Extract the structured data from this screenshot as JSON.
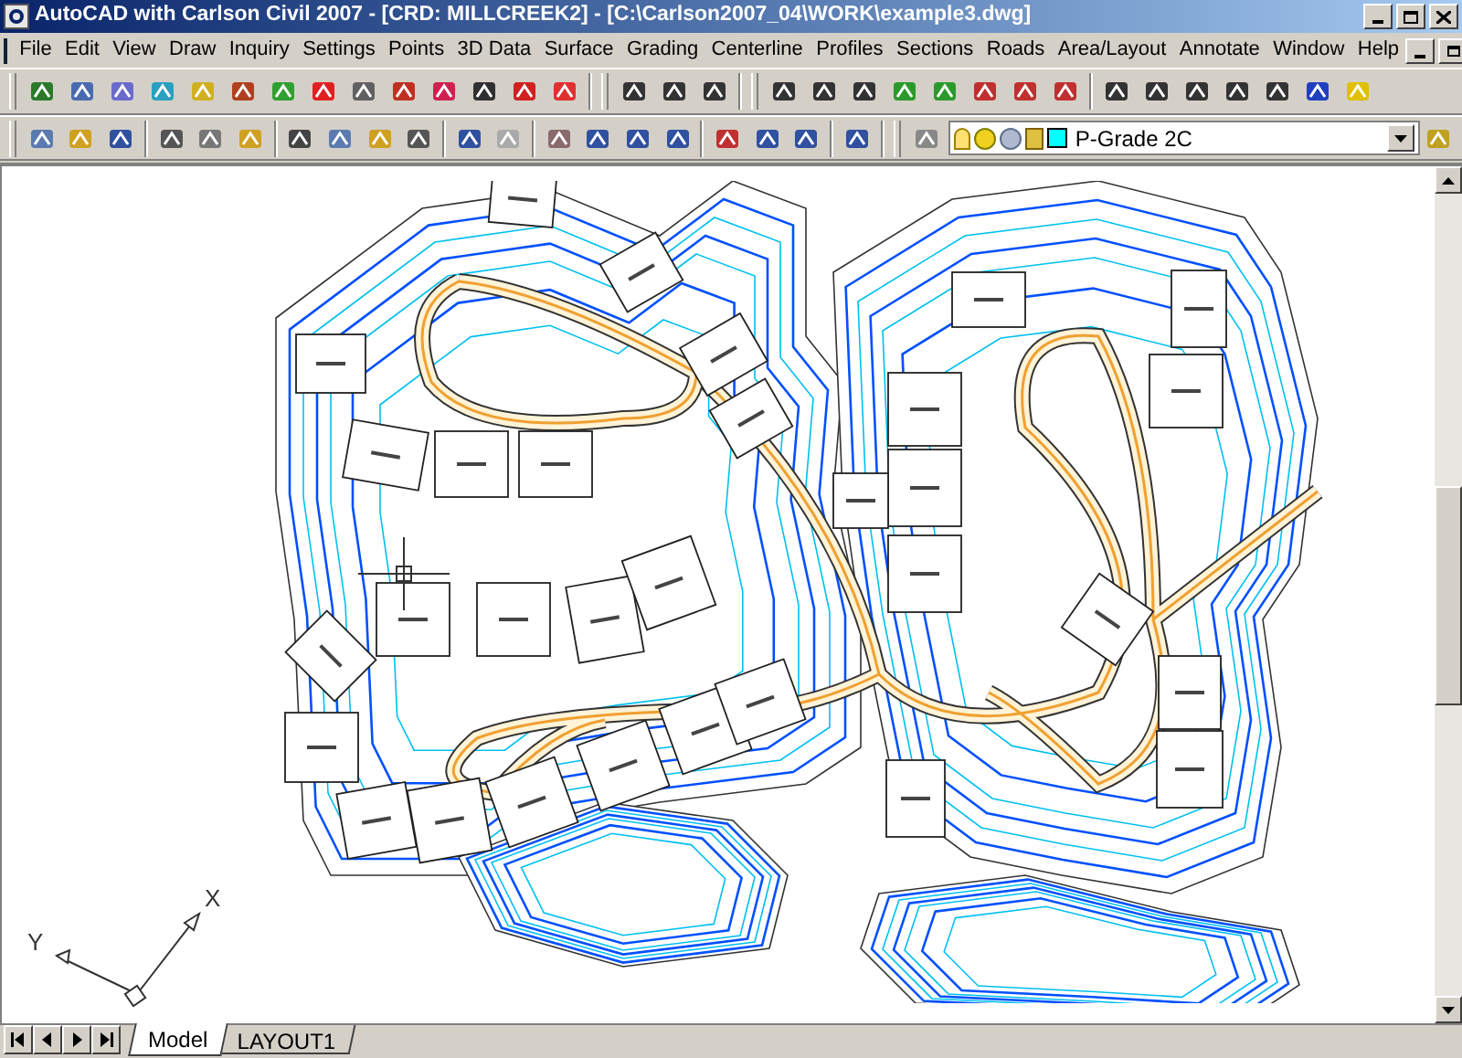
{
  "window": {
    "title": "AutoCAD with Carlson Civil 2007 - [CRD: MILLCREEK2] - [C:\\Carlson2007_04\\WORK\\example3.dwg]"
  },
  "menu": [
    "File",
    "Edit",
    "View",
    "Draw",
    "Inquiry",
    "Settings",
    "Points",
    "3D Data",
    "Surface",
    "Grading",
    "Centerline",
    "Profiles",
    "Sections",
    "Roads",
    "Area/Layout",
    "Annotate",
    "Window",
    "Help"
  ],
  "layer": {
    "value": "P-Grade 2C"
  },
  "ucs": {
    "x_label": "X",
    "y_label": "Y"
  },
  "tabs": [
    {
      "label": "Model",
      "selected": true
    },
    {
      "label": "LAYOUT1",
      "selected": false
    }
  ]
}
